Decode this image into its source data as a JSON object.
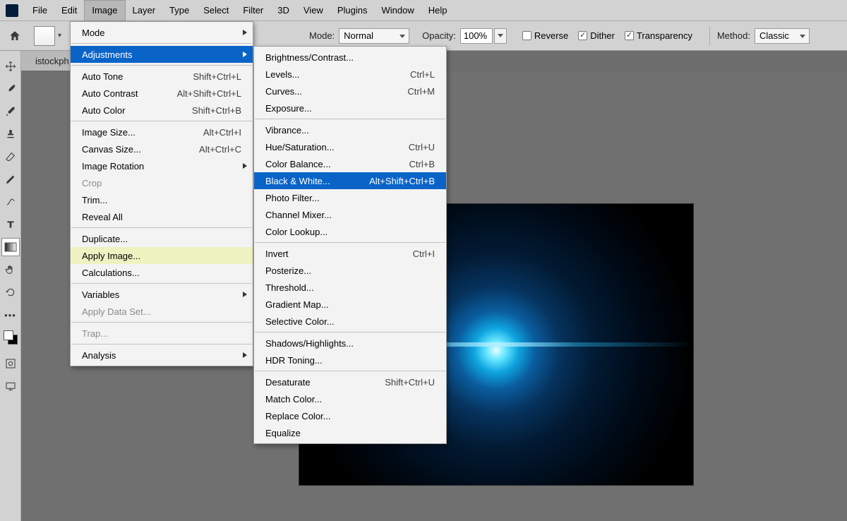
{
  "menubar": {
    "items": [
      "File",
      "Edit",
      "Image",
      "Layer",
      "Type",
      "Select",
      "Filter",
      "3D",
      "View",
      "Plugins",
      "Window",
      "Help"
    ],
    "active": "Image"
  },
  "optionsbar": {
    "mode_label": "Mode:",
    "mode_value": "Normal",
    "opacity_label": "Opacity:",
    "opacity_value": "100%",
    "reverse_label": "Reverse",
    "dither_label": "Dither",
    "transparency_label": "Transparency",
    "method_label": "Method:",
    "method_value": "Classic"
  },
  "tab": {
    "title": "istockph"
  },
  "image_menu": [
    {
      "type": "item",
      "label": "Mode",
      "submenu": true
    },
    {
      "type": "sep"
    },
    {
      "type": "item",
      "label": "Adjustments",
      "submenu": true,
      "selected": true
    },
    {
      "type": "sep"
    },
    {
      "type": "item",
      "label": "Auto Tone",
      "shortcut": "Shift+Ctrl+L"
    },
    {
      "type": "item",
      "label": "Auto Contrast",
      "shortcut": "Alt+Shift+Ctrl+L"
    },
    {
      "type": "item",
      "label": "Auto Color",
      "shortcut": "Shift+Ctrl+B"
    },
    {
      "type": "sep"
    },
    {
      "type": "item",
      "label": "Image Size...",
      "shortcut": "Alt+Ctrl+I"
    },
    {
      "type": "item",
      "label": "Canvas Size...",
      "shortcut": "Alt+Ctrl+C"
    },
    {
      "type": "item",
      "label": "Image Rotation",
      "submenu": true
    },
    {
      "type": "item",
      "label": "Crop",
      "disabled": true
    },
    {
      "type": "item",
      "label": "Trim..."
    },
    {
      "type": "item",
      "label": "Reveal All"
    },
    {
      "type": "sep"
    },
    {
      "type": "item",
      "label": "Duplicate..."
    },
    {
      "type": "item",
      "label": "Apply Image...",
      "hover": true
    },
    {
      "type": "item",
      "label": "Calculations..."
    },
    {
      "type": "sep"
    },
    {
      "type": "item",
      "label": "Variables",
      "submenu": true
    },
    {
      "type": "item",
      "label": "Apply Data Set...",
      "disabled": true
    },
    {
      "type": "sep"
    },
    {
      "type": "item",
      "label": "Trap...",
      "disabled": true
    },
    {
      "type": "sep"
    },
    {
      "type": "item",
      "label": "Analysis",
      "submenu": true
    }
  ],
  "adjust_menu": [
    {
      "type": "item",
      "label": "Brightness/Contrast..."
    },
    {
      "type": "item",
      "label": "Levels...",
      "shortcut": "Ctrl+L"
    },
    {
      "type": "item",
      "label": "Curves...",
      "shortcut": "Ctrl+M"
    },
    {
      "type": "item",
      "label": "Exposure..."
    },
    {
      "type": "sep"
    },
    {
      "type": "item",
      "label": "Vibrance..."
    },
    {
      "type": "item",
      "label": "Hue/Saturation...",
      "shortcut": "Ctrl+U"
    },
    {
      "type": "item",
      "label": "Color Balance...",
      "shortcut": "Ctrl+B"
    },
    {
      "type": "item",
      "label": "Black & White...",
      "shortcut": "Alt+Shift+Ctrl+B",
      "selected": true
    },
    {
      "type": "item",
      "label": "Photo Filter..."
    },
    {
      "type": "item",
      "label": "Channel Mixer..."
    },
    {
      "type": "item",
      "label": "Color Lookup..."
    },
    {
      "type": "sep"
    },
    {
      "type": "item",
      "label": "Invert",
      "shortcut": "Ctrl+I"
    },
    {
      "type": "item",
      "label": "Posterize..."
    },
    {
      "type": "item",
      "label": "Threshold..."
    },
    {
      "type": "item",
      "label": "Gradient Map..."
    },
    {
      "type": "item",
      "label": "Selective Color..."
    },
    {
      "type": "sep"
    },
    {
      "type": "item",
      "label": "Shadows/Highlights..."
    },
    {
      "type": "item",
      "label": "HDR Toning..."
    },
    {
      "type": "sep"
    },
    {
      "type": "item",
      "label": "Desaturate",
      "shortcut": "Shift+Ctrl+U"
    },
    {
      "type": "item",
      "label": "Match Color..."
    },
    {
      "type": "item",
      "label": "Replace Color..."
    },
    {
      "type": "item",
      "label": "Equalize"
    }
  ]
}
